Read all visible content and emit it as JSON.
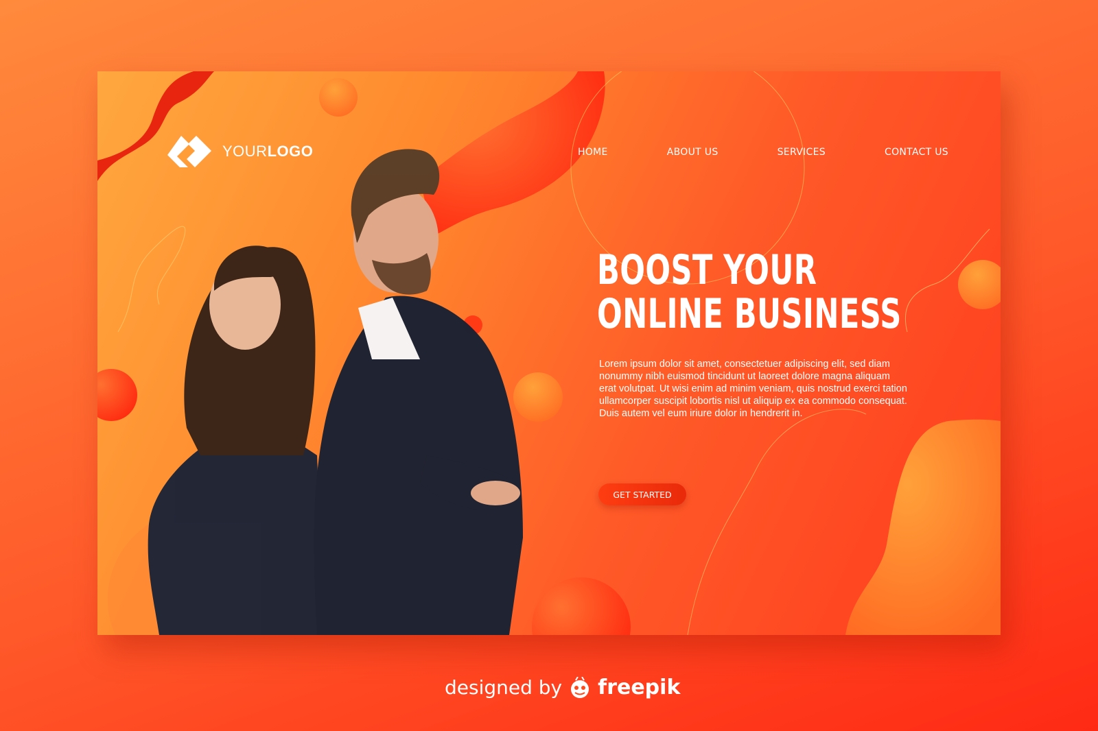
{
  "logo": {
    "text_regular": "YOUR",
    "text_bold": "LOGO",
    "icon": "diamond-logo-icon"
  },
  "nav": {
    "items": [
      {
        "label": "HOME"
      },
      {
        "label": "ABOUT US"
      },
      {
        "label": "SERVICES"
      },
      {
        "label": "CONTACT US"
      }
    ]
  },
  "hero": {
    "headline_line1": "BOOST YOUR",
    "headline_line2": "ONLINE BUSINESS",
    "body": "Lorem ipsum dolor sit amet, consectetuer adipiscing elit, sed diam nonummy nibh euismod tincidunt ut laoreet dolore magna aliquam erat volutpat. Ut wisi enim ad minim veniam, quis nostrud exerci tation ullamcorper suscipit lobortis nisl ut aliquip ex ea commodo consequat. Duis autem vel eum iriure dolor in hendrerit in.",
    "cta_label": "GET STARTED"
  },
  "credit": {
    "prefix": "designed by",
    "brand": "freepik",
    "icon": "freepik-mascot-icon"
  },
  "colors": {
    "background": "#ff5a2a",
    "card_orange": "#ffa83f",
    "card_red": "#ff3c1e",
    "accent_red": "#ff3d12",
    "text": "#ffffff"
  }
}
